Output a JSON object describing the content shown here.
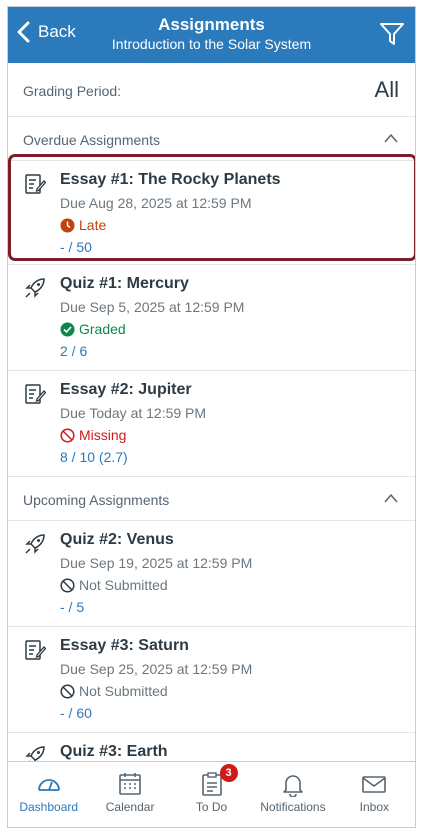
{
  "header": {
    "back_label": "Back",
    "title": "Assignments",
    "subtitle": "Introduction to the Solar System"
  },
  "grading": {
    "label": "Grading Period:",
    "value": "All"
  },
  "sections": {
    "overdue": "Overdue Assignments",
    "upcoming": "Upcoming Assignments"
  },
  "overdue": [
    {
      "icon": "assignment-icon",
      "name": "Essay #1: The Rocky Planets",
      "due": "Due Aug 28, 2025 at 12:59 PM",
      "status": "Late",
      "score": "- / 50"
    },
    {
      "icon": "quiz-icon",
      "name": "Quiz #1: Mercury",
      "due": "Due Sep 5, 2025 at 12:59 PM",
      "status": "Graded",
      "score": "2 / 6"
    },
    {
      "icon": "assignment-icon",
      "name": "Essay #2: Jupiter",
      "due": "Due Today at 12:59 PM",
      "status": "Missing",
      "score": "8 / 10 (2.7)"
    }
  ],
  "upcoming": [
    {
      "icon": "quiz-icon",
      "name": "Quiz #2: Venus",
      "due": "Due Sep 19, 2025 at 12:59 PM",
      "status": "Not Submitted",
      "score": "- / 5"
    },
    {
      "icon": "assignment-icon",
      "name": "Essay #3: Saturn",
      "due": "Due Sep 25, 2025 at 12:59 PM",
      "status": "Not Submitted",
      "score": "- / 60"
    },
    {
      "icon": "quiz-icon",
      "name": "Quiz #3: Earth"
    }
  ],
  "tabs": [
    {
      "label": "Dashboard",
      "icon": "dashboard-icon"
    },
    {
      "label": "Calendar",
      "icon": "calendar-icon"
    },
    {
      "label": "To Do",
      "icon": "todo-icon",
      "badge": "3"
    },
    {
      "label": "Notifications",
      "icon": "bell-icon"
    },
    {
      "label": "Inbox",
      "icon": "inbox-icon"
    }
  ],
  "colors": {
    "brand": "#2b7abc",
    "late": "#c2410c",
    "graded": "#0b874b",
    "missing": "#d01a19",
    "highlight": "#7b1e28"
  }
}
